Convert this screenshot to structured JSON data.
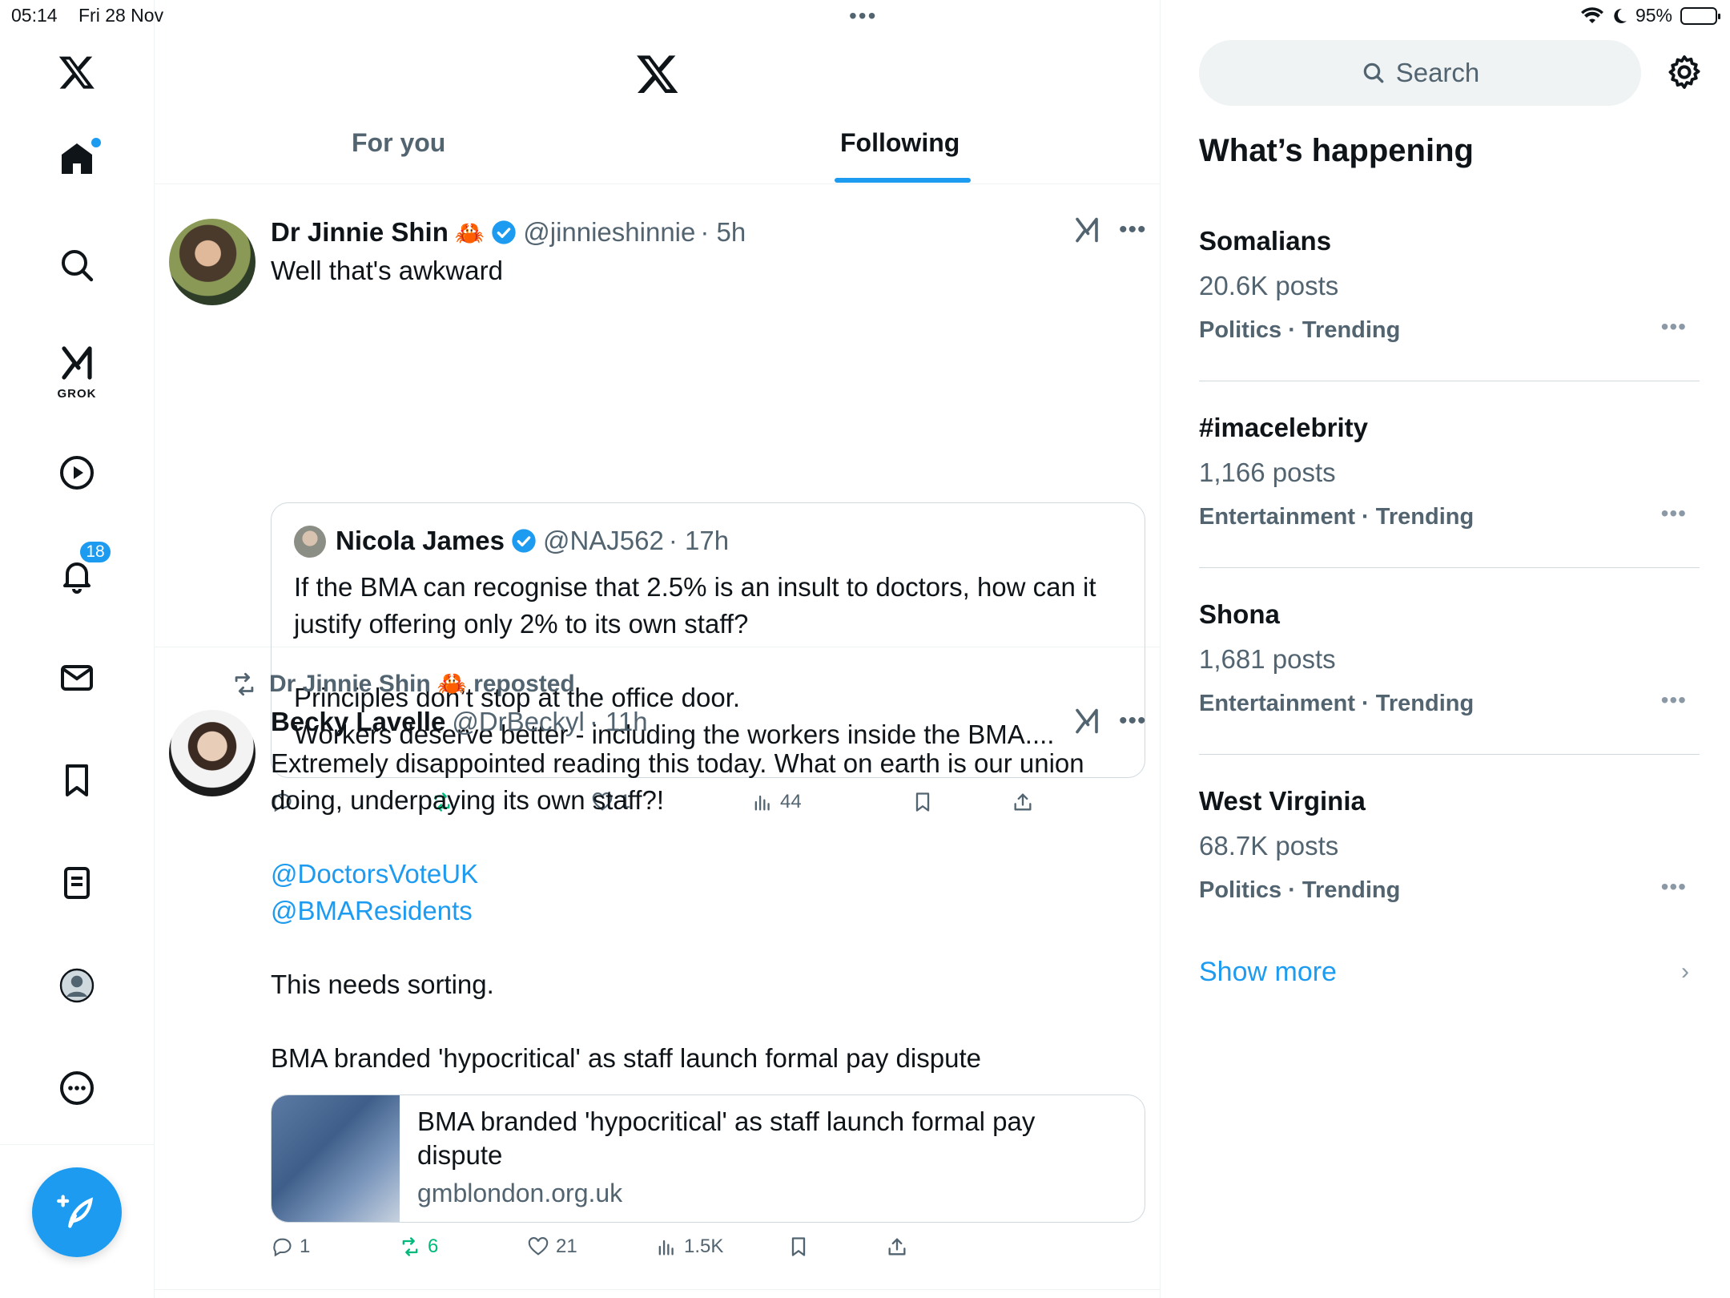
{
  "status": {
    "time": "05:14",
    "date": "Fri 28 Nov",
    "battery": "95%",
    "battery_level": 0.95
  },
  "nav": {
    "notifications_badge": "18",
    "grok_label": "GROK"
  },
  "header": {
    "tabs": [
      {
        "label": "For you"
      },
      {
        "label": "Following"
      }
    ]
  },
  "post1": {
    "name": "Dr Jinnie Shin",
    "emoji": "🦀",
    "handle": "@jinnieshinnie",
    "time": "· 5h",
    "text": "Well that's awkward",
    "quote": {
      "name": "Nicola James",
      "handle": "@NAJ562",
      "time": "· 17h",
      "text": "If the BMA can recognise that 2.5% is an insult to doctors, how can it justify offering only 2% to its own staff?\n\nPrinciples don’t stop at the office door.\nWorkers deserve better - including the workers inside the BMA...."
    },
    "actions": {
      "replies": "",
      "reposts": "",
      "likes": "1",
      "views": "44"
    }
  },
  "post2": {
    "repost_by": "Dr Jinnie Shin",
    "repost_emoji": "🦀",
    "repost_label": "reposted",
    "name": "Becky Lavelle",
    "handle": "@DrBeckyl",
    "time": "· 11h",
    "text_line1": "Extremely disappointed reading this today. What on earth is our union doing, underpaying its own staff?!",
    "mention1": "@DoctorsVoteUK",
    "mention2": "@BMAResidents",
    "text_line2": "This needs sorting.",
    "text_line3": "BMA branded 'hypocritical' as staff launch formal pay dispute",
    "card": {
      "title": "BMA branded 'hypocritical' as staff launch formal pay dispute",
      "domain": "gmblondon.org.uk"
    },
    "actions": {
      "replies": "1",
      "reposts": "6",
      "likes": "21",
      "views": "1.5K"
    }
  },
  "right": {
    "search_placeholder": "Search",
    "title": "What’s happening",
    "trends": [
      {
        "name": "Somalians",
        "count": "20.6K posts",
        "meta": "Politics · Trending"
      },
      {
        "name": "#imacelebrity",
        "count": "1,166 posts",
        "meta": "Entertainment · Trending"
      },
      {
        "name": "Shona",
        "count": "1,681 posts",
        "meta": "Entertainment · Trending"
      },
      {
        "name": "West Virginia",
        "count": "68.7K posts",
        "meta": "Politics · Trending"
      }
    ],
    "show_more": "Show more"
  },
  "colors": {
    "accent": "#1d9bf0",
    "repost_green": "#00ba7c",
    "secondary_text": "#536471"
  }
}
